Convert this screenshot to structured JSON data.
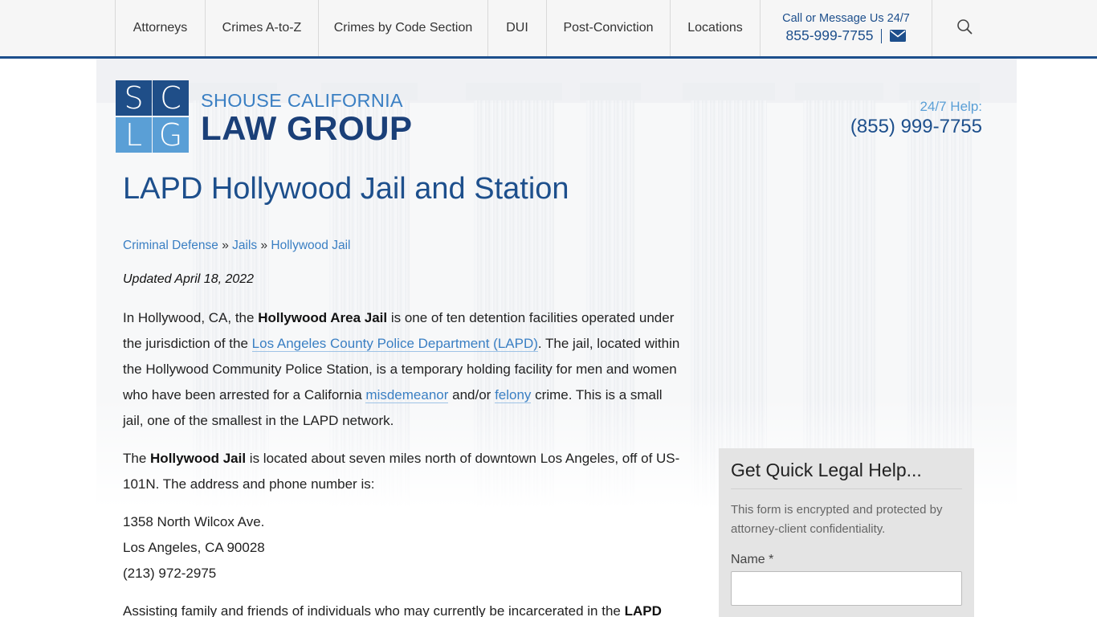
{
  "nav": {
    "items": [
      {
        "label": "Attorneys"
      },
      {
        "label": "Crimes A-to-Z"
      },
      {
        "label": "Crimes by Code Section"
      },
      {
        "label": "DUI"
      },
      {
        "label": "Post-Conviction"
      },
      {
        "label": "Locations"
      }
    ],
    "call_label": "Call or Message Us 24/7",
    "call_phone": "855-999-7755",
    "mail_icon": "envelope-icon",
    "search_icon": "search-icon"
  },
  "logo": {
    "letters": [
      "S",
      "C",
      "L",
      "G"
    ],
    "line1": "SHOUSE CALIFORNIA",
    "line2": "LAW GROUP",
    "colors": {
      "dark": "#1f4e88",
      "light": "#5a9fd6"
    }
  },
  "help": {
    "label": "24/7 Help:",
    "phone": "(855) 999-7755"
  },
  "page": {
    "title": "LAPD Hollywood Jail and Station",
    "breadcrumb": {
      "item1": "Criminal Defense",
      "sep1": "»",
      "item2": "Jails",
      "sep2": "»",
      "item3": "Hollywood Jail"
    },
    "updated": "Updated April 18, 2022",
    "p1": {
      "t1": "In Hollywood, CA, the ",
      "b1": "Hollywood Area Jail",
      "t2": " is one of ten detention facilities operated under the jurisdiction of the ",
      "link1": "Los Angeles County Police Department (LAPD)",
      "t3": ". The jail, located within the Hollywood Community Police Station, is a temporary holding facility for men and women who have been arrested for a California ",
      "link2": "misdemeanor",
      "t4": " and/or ",
      "link3": "felony",
      "t5": " crime. This is a small jail, one of the smallest in the LAPD network."
    },
    "p2": {
      "t1": "The ",
      "b1": "Hollywood Jail",
      "t2": " is located about seven miles north of downtown Los Angeles, off of US-101N. The address and phone number is:"
    },
    "address": {
      "line1": "1358 North Wilcox Ave.",
      "line2": "Los Angeles, CA 90028",
      "line3": "(213) 972-2975"
    },
    "p3": {
      "t1": "Assisting family and friends of individuals who may currently be incarcerated in the ",
      "b1": "LAPD"
    }
  },
  "form": {
    "title": "Get Quick Legal Help...",
    "note": "This form is encrypted and protected by attorney-client confidentiality.",
    "name_label": "Name *",
    "name_value": ""
  },
  "colors": {
    "brand": "#1d4f8c",
    "link": "#3a7fc3",
    "nav_bg": "#f6f6f6",
    "form_bg": "#e4e4e4"
  }
}
